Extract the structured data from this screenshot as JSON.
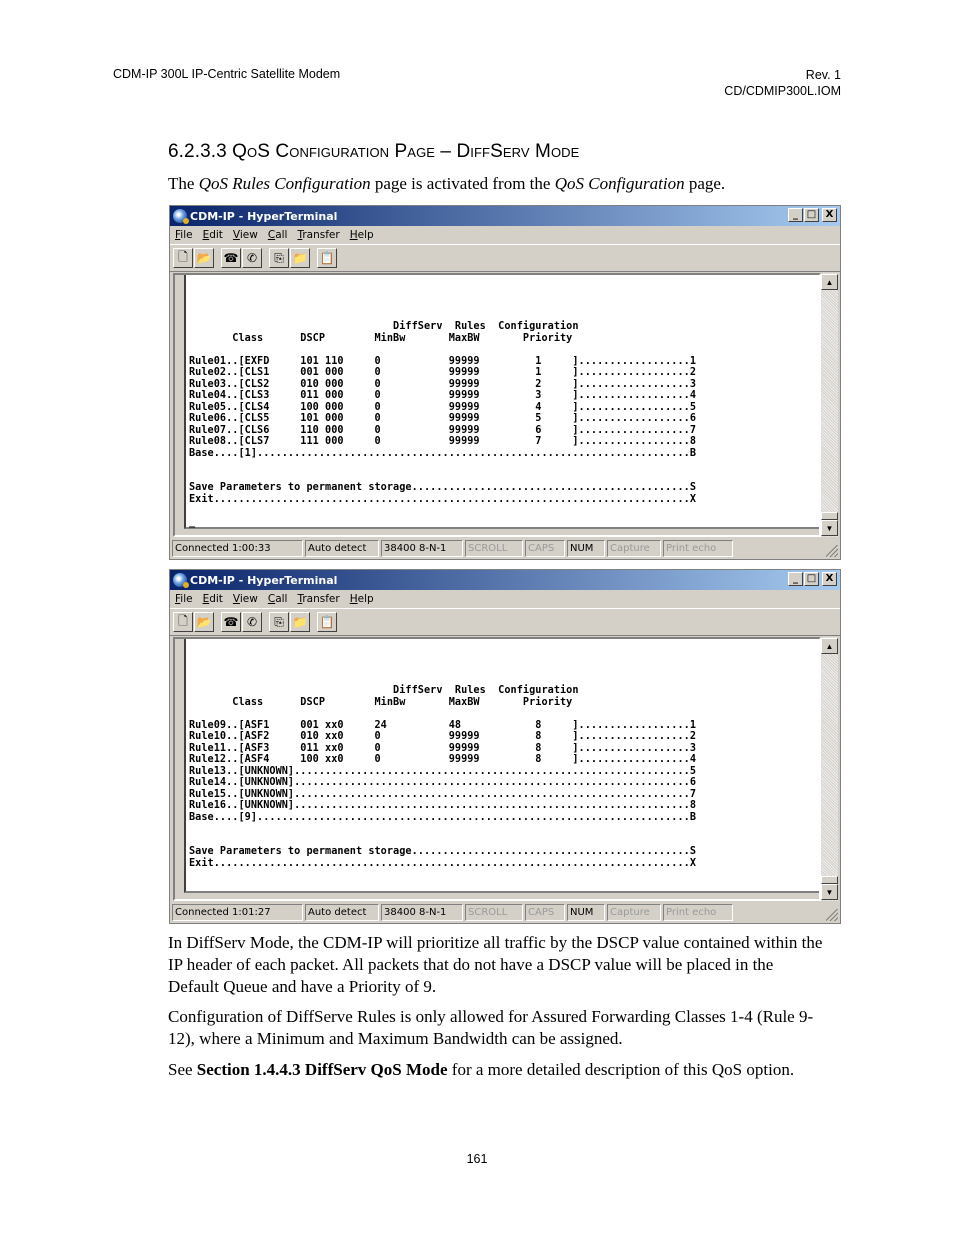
{
  "header": {
    "left": "CDM-IP 300L IP-Centric Satellite Modem",
    "right_line1": "Rev. 1",
    "right_line2": "CD/CDMIP300L.IOM"
  },
  "section": {
    "title": "6.2.3.3 QoS Configuration Page – DiffServ Mode",
    "intro_prefix": "The ",
    "intro_em1": "QoS Rules Configuration",
    "intro_mid": " page is activated from the ",
    "intro_em2": "QoS Configuration",
    "intro_suffix": " page."
  },
  "window_common": {
    "title": "CDM-IP - HyperTerminal",
    "menu": [
      "File",
      "Edit",
      "View",
      "Call",
      "Transfer",
      "Help"
    ],
    "menu_underline_letters": [
      "F",
      "E",
      "V",
      "C",
      "T",
      "H"
    ],
    "toolbar_icons": [
      "new-icon",
      "open-icon",
      "connect-icon",
      "disconnect-icon",
      "send-icon",
      "receive-icon",
      "properties-icon"
    ],
    "win_buttons": {
      "minimize": "_",
      "maximize": "□",
      "close": "X"
    },
    "scroll_up": "▲",
    "scroll_down": "▼"
  },
  "window1": {
    "terminal_lines": [
      "                                 DiffServ  Rules  Configuration",
      "       Class      DSCP        MinBw       MaxBW       Priority",
      "",
      "Rule01..[EXFD     101 110     0           99999         1     ]..................1",
      "Rule02..[CLS1     001 000     0           99999         1     ]..................2",
      "Rule03..[CLS2     010 000     0           99999         2     ]..................3",
      "Rule04..[CLS3     011 000     0           99999         3     ]..................4",
      "Rule05..[CLS4     100 000     0           99999         4     ]..................5",
      "Rule06..[CLS5     101 000     0           99999         5     ]..................6",
      "Rule07..[CLS6     110 000     0           99999         6     ]..................7",
      "Rule08..[CLS7     111 000     0           99999         7     ]..................8",
      "Base....[1]......................................................................B",
      "",
      "",
      "Save Parameters to permanent storage.............................................S",
      "Exit.............................................................................X",
      "",
      "_"
    ],
    "status": {
      "connected": "Connected 1:00:33",
      "detect": "Auto detect",
      "baud": "38400 8-N-1",
      "scroll": "SCROLL",
      "caps": "CAPS",
      "num": "NUM",
      "capture": "Capture",
      "print_echo": "Print echo"
    }
  },
  "window2": {
    "terminal_lines": [
      "                                 DiffServ  Rules  Configuration",
      "       Class      DSCP        MinBw       MaxBW       Priority",
      "",
      "Rule09..[ASF1     001 xx0     24          48            8     ]..................1",
      "Rule10..[ASF2     010 xx0     0           99999         8     ]..................2",
      "Rule11..[ASF3     011 xx0     0           99999         8     ]..................3",
      "Rule12..[ASF4     100 xx0     0           99999         8     ]..................4",
      "Rule13..[UNKNOWN]................................................................5",
      "Rule14..[UNKNOWN]................................................................6",
      "Rule15..[UNKNOWN]................................................................7",
      "Rule16..[UNKNOWN]................................................................8",
      "Base....[9]......................................................................B",
      "",
      "",
      "Save Parameters to permanent storage.............................................S",
      "Exit.............................................................................X"
    ],
    "status": {
      "connected": "Connected 1:01:27",
      "detect": "Auto detect",
      "baud": "38400 8-N-1",
      "scroll": "SCROLL",
      "caps": "CAPS",
      "num": "NUM",
      "capture": "Capture",
      "print_echo": "Print echo"
    }
  },
  "body": {
    "p1": "In DiffServ Mode, the CDM-IP will prioritize all traffic by the DSCP value contained within the IP header of each packet. All packets that do not have a DSCP value will be placed in the Default Queue and have a Priority of 9.",
    "p2": "Configuration of DiffServe Rules is only allowed for Assured Forwarding Classes 1-4 (Rule 9-12), where a Minimum and Maximum Bandwidth can be assigned.",
    "p3_prefix": "See ",
    "p3_bold": "Section 1.4.4.3 DiffServ QoS Mode",
    "p3_suffix": " for a more detailed description of this QoS option."
  },
  "page_number": "161"
}
